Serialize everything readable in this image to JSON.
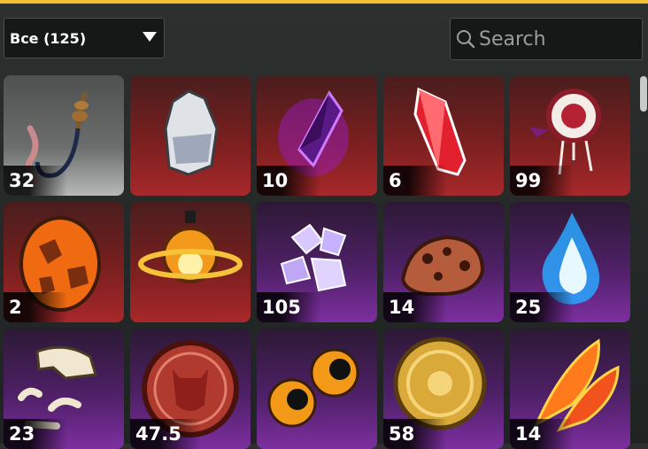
{
  "filter": {
    "label": "Все (125)"
  },
  "search": {
    "placeholder": "Search"
  },
  "items": [
    {
      "name": "hook-rope",
      "count": "32",
      "rarity": "gray"
    },
    {
      "name": "silver-crystal",
      "count": "",
      "rarity": "red"
    },
    {
      "name": "purple-crystal",
      "count": "10",
      "rarity": "red"
    },
    {
      "name": "red-crystal",
      "count": "6",
      "rarity": "red"
    },
    {
      "name": "dreamcatcher",
      "count": "99",
      "rarity": "red"
    },
    {
      "name": "lava-egg",
      "count": "2",
      "rarity": "red"
    },
    {
      "name": "fire-orb",
      "count": "",
      "rarity": "red"
    },
    {
      "name": "glass-shards",
      "count": "105",
      "rarity": "purple"
    },
    {
      "name": "cookie-rock",
      "count": "14",
      "rarity": "purple"
    },
    {
      "name": "blue-flame",
      "count": "25",
      "rarity": "purple"
    },
    {
      "name": "fossil",
      "count": "23",
      "rarity": "purple"
    },
    {
      "name": "demon-coin",
      "count": "47.5",
      "rarity": "purple"
    },
    {
      "name": "eyes",
      "count": "",
      "rarity": "purple"
    },
    {
      "name": "sun-coin",
      "count": "58",
      "rarity": "purple"
    },
    {
      "name": "phoenix-feathers",
      "count": "14",
      "rarity": "purple"
    }
  ]
}
